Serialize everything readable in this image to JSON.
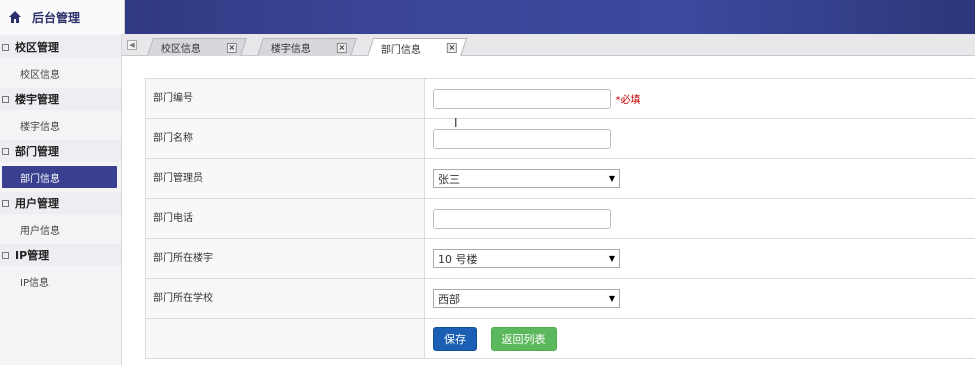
{
  "app": {
    "title": "后台管理",
    "home_icon": "home-icon"
  },
  "sidebar": {
    "groups": [
      {
        "label": "校区管理",
        "items": [
          {
            "label": "校区信息",
            "active": false
          }
        ]
      },
      {
        "label": "楼宇管理",
        "items": [
          {
            "label": "楼宇信息",
            "active": false
          }
        ]
      },
      {
        "label": "部门管理",
        "items": [
          {
            "label": "部门信息",
            "active": true
          }
        ]
      },
      {
        "label": "用户管理",
        "items": [
          {
            "label": "用户信息",
            "active": false
          }
        ]
      },
      {
        "label": "IP管理",
        "items": [
          {
            "label": "IP信息",
            "active": false
          }
        ]
      }
    ]
  },
  "tabs": [
    {
      "label": "校区信息",
      "active": false
    },
    {
      "label": "楼宇信息",
      "active": false
    },
    {
      "label": "部门信息",
      "active": true
    }
  ],
  "form": {
    "fields": [
      {
        "label": "部门编号",
        "type": "text",
        "value": "",
        "required_note": "*必填"
      },
      {
        "label": "部门名称",
        "type": "text",
        "value": ""
      },
      {
        "label": "部门管理员",
        "type": "select",
        "value": "张三"
      },
      {
        "label": "部门电话",
        "type": "text",
        "value": ""
      },
      {
        "label": "部门所在楼宇",
        "type": "select",
        "value": "10 号楼"
      },
      {
        "label": "部门所在学校",
        "type": "select",
        "value": "西部"
      }
    ],
    "save_label": "保存",
    "back_label": "返回列表"
  },
  "colors": {
    "topbar": "#3a4596",
    "active_nav": "#3a3f8f",
    "save": "#1a5fb4",
    "back": "#5cb85c",
    "required": "#c00000"
  }
}
